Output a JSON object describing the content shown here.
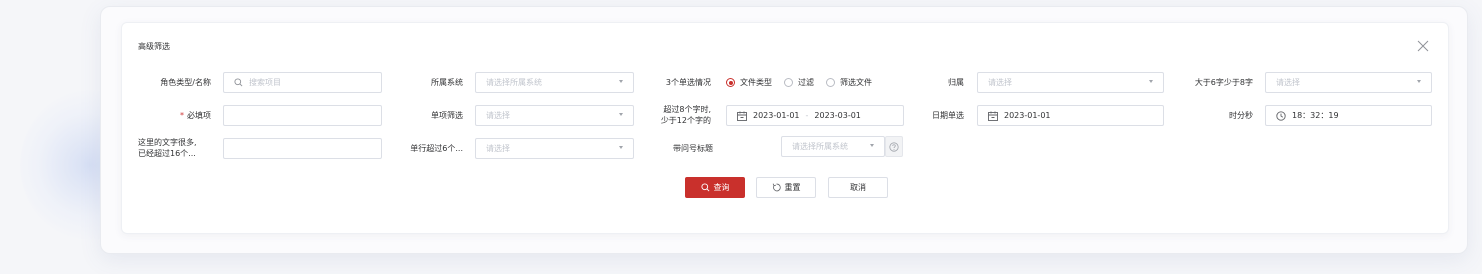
{
  "panel": {
    "title": "高级筛选"
  },
  "row1": {
    "role_label": "角色类型/名称",
    "search_placeholder": "搜索项目",
    "system_label": "所属系统",
    "system_placeholder": "请选择所属系统",
    "radio_label": "3个单选情况",
    "radios": [
      {
        "label": "文件类型",
        "checked": true
      },
      {
        "label": "过滤",
        "checked": false
      },
      {
        "label": "筛选文件",
        "checked": false
      }
    ],
    "owner_label": "归属",
    "owner_placeholder": "请选择",
    "range_label": "大于6字少于8字",
    "range_placeholder": "请选择"
  },
  "row2": {
    "required_mark": "*",
    "required_label": "必填项",
    "single_label": "单项筛选",
    "single_placeholder": "请选择",
    "long_label_line1": "超过8个字时,",
    "long_label_line2": "少于12个字的",
    "date_start": "2023-01-01",
    "date_sep": "-",
    "date_end": "2023-03-01",
    "date_single_label": "日期单选",
    "date_single_value": "2023-01-01",
    "time_label": "时分秒",
    "time_value": "18：32：19"
  },
  "row3": {
    "many_text_line1": "这里的文字很多,",
    "many_text_line2": "已经超过16个...",
    "row_overflow_label": "单行超过6个...",
    "row_overflow_placeholder": "请选择",
    "question_label": "带问号标题",
    "question_placeholder": "请选择所属系统"
  },
  "actions": {
    "search": "查询",
    "reset": "重置",
    "cancel": "取消"
  },
  "colors": {
    "primary": "#c9302c",
    "border": "#dcdfe6",
    "placeholder": "#c0c4cc"
  }
}
